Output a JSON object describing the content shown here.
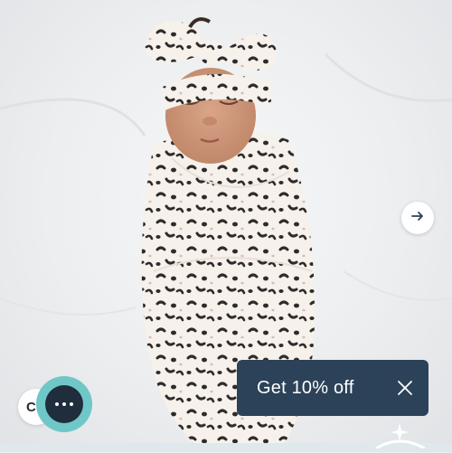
{
  "hero": {
    "image_description_icon": "swaddled-baby-leopard-print"
  },
  "carousel": {
    "next_icon": "arrow-right-icon"
  },
  "thumbnail": {
    "label": "C"
  },
  "chat": {
    "icon": "chat-bubble-icon"
  },
  "promo": {
    "label": "Get 10% off",
    "close_icon": "close-icon"
  },
  "colors": {
    "promo_bg": "#2c4259",
    "chat_ring": "#6fc7c7",
    "chat_inner": "#1f2d3d",
    "pattern_spot": "#2f2a2c",
    "fabric": "#f6f1ea"
  }
}
